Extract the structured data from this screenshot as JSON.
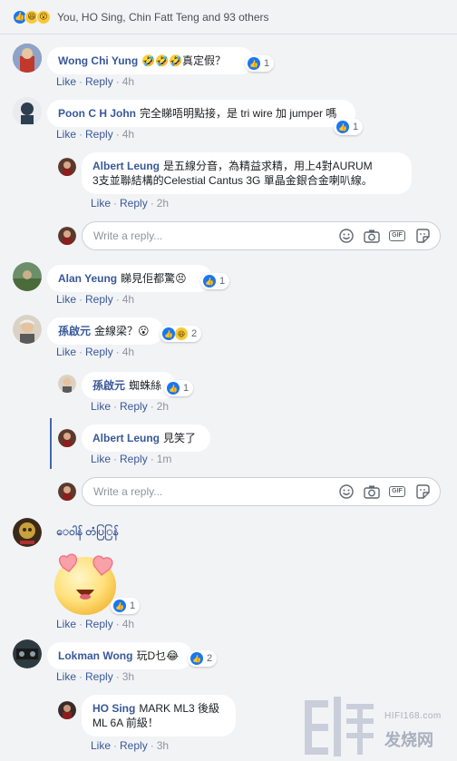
{
  "reactions_summary": {
    "text": "You, HO Sing, Chin Fatt Teng and 93 others",
    "icons": [
      "like-icon",
      "haha-icon",
      "wow-icon"
    ]
  },
  "comments": [
    {
      "author": "Wong Chi Yung",
      "text": "🤣🤣🤣真定假？",
      "likes": "1",
      "like_label": "Like",
      "reply_label": "Reply",
      "time": "4h"
    },
    {
      "author": "Poon C H John",
      "text": "完全睇唔明點接，是 tri wire 加 jumper 嗎",
      "likes": "1",
      "like_label": "Like",
      "reply_label": "Reply",
      "time": "4h",
      "replies": [
        {
          "author": "Albert Leung",
          "text_line1": "是五線分音，為精益求精，用上4對AURUM",
          "text_line2": "3支並聯結構的Celestial Cantus 3G 單晶金銀合金喇叭線。",
          "like_label": "Like",
          "reply_label": "Reply",
          "time": "2h"
        }
      ],
      "reply_placeholder": "Write a reply..."
    },
    {
      "author": "Alan Yeung",
      "text": "睇見佢都驚😣",
      "likes": "1",
      "like_label": "Like",
      "reply_label": "Reply",
      "time": "4h"
    },
    {
      "author": "孫啟元",
      "text": "金線梁？😮",
      "likes": "2",
      "like_label": "Like",
      "reply_label": "Reply",
      "time": "4h",
      "replies": [
        {
          "author": "孫啟元",
          "text": "蜘蛛絲",
          "likes": "1",
          "like_label": "Like",
          "reply_label": "Reply",
          "time": "2h"
        },
        {
          "author": "Albert Leung",
          "text": "見笑了",
          "like_label": "Like",
          "reply_label": "Reply",
          "time": "1m"
        }
      ],
      "reply_placeholder": "Write a reply..."
    },
    {
      "author": "ေဝါန် တံပြြန်",
      "sticker": "heart-eyes-sticker",
      "likes": "1",
      "like_label": "Like",
      "reply_label": "Reply",
      "time": "4h"
    },
    {
      "author": "Lokman Wong",
      "text": "玩D乜😂",
      "likes": "2",
      "like_label": "Like",
      "reply_label": "Reply",
      "time": "3h",
      "replies": [
        {
          "author": "HO Sing",
          "text_line1": "MARK ML3 後級",
          "text_line2": "ML 6A 前級！",
          "like_label": "Like",
          "reply_label": "Reply",
          "time": "3h"
        }
      ]
    }
  ],
  "watermark": {
    "site": "HIFI168.com",
    "brand": "发烧网"
  },
  "colors": {
    "link": "#385898",
    "like_blue": "#1877f2",
    "background": "#f2f3f5",
    "thread_line": "#4267b2"
  }
}
